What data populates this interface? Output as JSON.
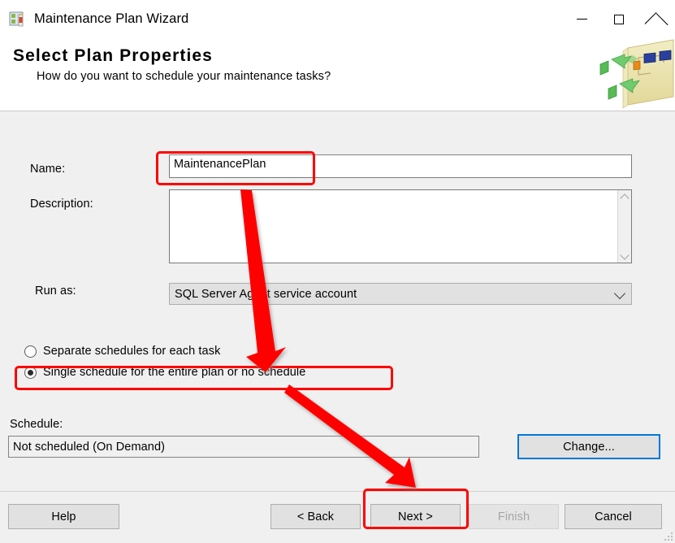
{
  "window": {
    "title": "Maintenance Plan Wizard",
    "icon": "maintenance-plan-icon",
    "controls": {
      "minimize": "minimize-icon",
      "maximize": "maximize-icon",
      "close": "close-icon"
    }
  },
  "banner": {
    "title": "Select Plan Properties",
    "subtitle": "How do you want to schedule your maintenance tasks?",
    "art": "maintenance-plan-diagram-graphic"
  },
  "form": {
    "name_label": "Name:",
    "name_value": "MaintenancePlan",
    "name_placeholder": "",
    "description_label": "Description:",
    "description_value": "",
    "description_placeholder": "",
    "run_as_label": "Run as:",
    "run_as_value": "SQL Server Agent service account",
    "run_as_options": [
      "SQL Server Agent service account"
    ],
    "schedule_mode": {
      "separate_label": "Separate schedules for each task",
      "single_label": "Single schedule for the entire plan or no schedule",
      "selected": "single"
    },
    "schedule_label": "Schedule:",
    "schedule_value": "Not scheduled (On Demand)",
    "change_button": "Change..."
  },
  "footer": {
    "help": "Help",
    "back": "< Back",
    "next": "Next >",
    "finish": "Finish",
    "cancel": "Cancel",
    "finish_disabled": true
  },
  "annotations": {
    "color": "#ff0000",
    "highlight_name_field": true,
    "highlight_single_schedule_radio": true,
    "highlight_next_button": true,
    "arrow_count": 2
  }
}
